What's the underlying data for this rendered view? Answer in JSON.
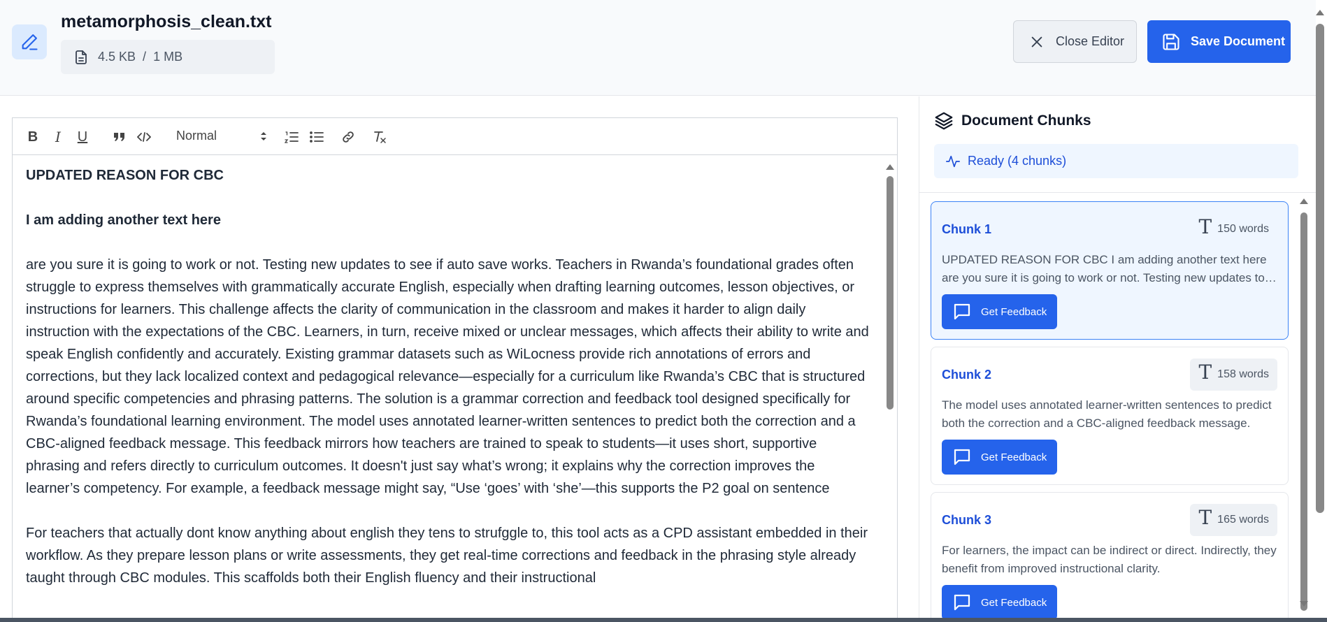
{
  "header": {
    "file_name": "metamorphosis_clean.txt",
    "file_size": "4.5 KB",
    "size_separator": "/",
    "size_limit": "1 MB",
    "close_label": "Close Editor",
    "save_label": "Save Document"
  },
  "toolbar": {
    "bold": "B",
    "italic": "I",
    "underline": "U",
    "heading_select": "Normal"
  },
  "editor": {
    "paragraphs": [
      "UPDATED REASON FOR CBC",
      "I am adding another text here",
      "are you sure it is going to work or not. Testing new updates to see if auto save works. Teachers in Rwanda’s foundational grades often struggle to express themselves with grammatically accurate English, especially when drafting learning outcomes, lesson objectives, or instructions for learners. This challenge affects the clarity of communication in the classroom and makes it harder to align daily instruction with the expectations of the CBC. Learners, in turn, receive mixed or unclear messages, which affects their ability to write and speak English confidently and accurately. Existing grammar datasets such as WiLocness provide rich annotations of errors and corrections, but they lack localized context and pedagogical relevance—especially for a curriculum like Rwanda’s CBC that is structured around specific competencies and phrasing patterns. The solution is a grammar correction and feedback tool designed specifically for Rwanda’s foundational learning environment. The model uses annotated learner-written sentences to predict both the correction and a CBC-aligned feedback message. This feedback mirrors how teachers are trained to speak to students—it uses short, supportive phrasing and refers directly to curriculum outcomes. It doesn't just say what’s wrong; it explains why the correction improves the learner’s competency. For example, a feedback message might say, “Use ‘goes’ with ‘she’—this supports the P2 goal on sentence",
      "For teachers that actually dont know anything about english they tens to strufggle to, this tool acts as a CPD assistant embedded in their workflow. As they prepare lesson plans or write assessments, they get real-time corrections and feedback in the phrasing style already taught through CBC modules. This scaffolds both their English fluency and their instructional"
    ]
  },
  "sidebar": {
    "title": "Document Chunks",
    "status": "Ready (4 chunks)",
    "chunks": [
      {
        "title": "Chunk 1",
        "words": "150 words",
        "preview": "UPDATED REASON FOR CBC I am adding another text here are you sure it is going to work or not. Testing new updates to see if auto save works.",
        "button": "Get Feedback"
      },
      {
        "title": "Chunk 2",
        "words": "158 words",
        "preview": "The model uses annotated learner-written sentences to predict both the correction and a CBC-aligned feedback message.",
        "button": "Get Feedback"
      },
      {
        "title": "Chunk 3",
        "words": "165 words",
        "preview": "For learners, the impact can be indirect or direct. Indirectly, they benefit from improved instructional clarity.",
        "button": "Get Feedback"
      }
    ]
  },
  "colors": {
    "accent": "#2563eb",
    "accent_light": "#eff6ff",
    "header_bg": "#f8fafc"
  }
}
